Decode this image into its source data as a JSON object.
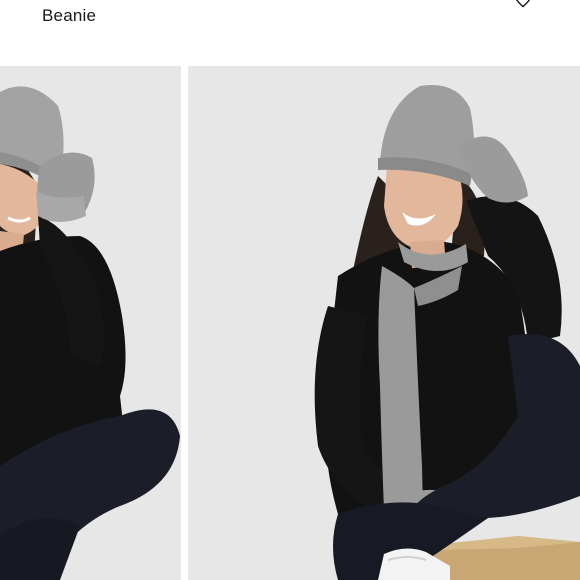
{
  "product": {
    "name": "Beanie"
  },
  "icons": {
    "favorite": "heart-outline-icon"
  },
  "colors": {
    "background": "#ffffff",
    "photo_backdrop": "#e7e7e7",
    "knit_gray": "#9a9a9a",
    "sweater_black": "#121212",
    "jeans_navy": "#1b1e29"
  }
}
